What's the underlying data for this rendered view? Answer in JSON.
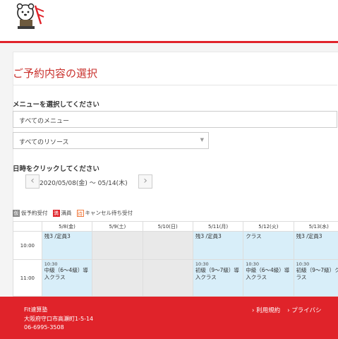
{
  "header": {
    "logo_icon": "mascot-logo-icon"
  },
  "main": {
    "title": "ご予約内容の選択",
    "menu_label": "メニューを選択してください",
    "menu_select": "すべてのメニュー",
    "resource_select": "すべてのリソース",
    "date_label": "日時をクリックしてください",
    "date_range": "2020/05/08(金) ～ 05/14(木)",
    "prev_icon": "chevron-left-icon",
    "next_icon": "chevron-right-icon",
    "legend": [
      {
        "chip": "仮",
        "label": "仮予約受付",
        "color": "#888888"
      },
      {
        "chip": "満",
        "label": "満員",
        "color": "#e0232a"
      },
      {
        "chip": "待",
        "label": "キャンセル待ち受付",
        "color": "#f07b3f"
      }
    ]
  },
  "schedule": {
    "columns": [
      "5/8(金)",
      "5/9(土)",
      "5/10(日)",
      "5/11(月)",
      "5/12(火)",
      "5/13(水)"
    ],
    "rows": [
      {
        "time": "10:00",
        "cells": [
          {
            "text": "残3 /定員3"
          },
          null,
          null,
          {
            "text": "残3 /定員3"
          },
          {
            "text": "クラス"
          },
          {
            "text": "残3 /定員3"
          }
        ]
      },
      {
        "time": "11:00",
        "cells": [
          {
            "t": "10:30",
            "text": "中級（6〜4級）導入クラス"
          },
          null,
          null,
          {
            "t": "10:30",
            "text": "初級（9〜7級）導入クラス"
          },
          {
            "t": "10:30",
            "text": "中級（6〜4級）導入クラス"
          },
          {
            "t": "10:30",
            "text": "初級（9〜7級）クラス"
          }
        ]
      }
    ]
  },
  "footer": {
    "name": "Fit速算塾",
    "address": "大阪府守口市高瀬町1-5-14",
    "phone": "06-6995-3508",
    "terms": "› 利用規約",
    "privacy": "› プライバシ"
  }
}
